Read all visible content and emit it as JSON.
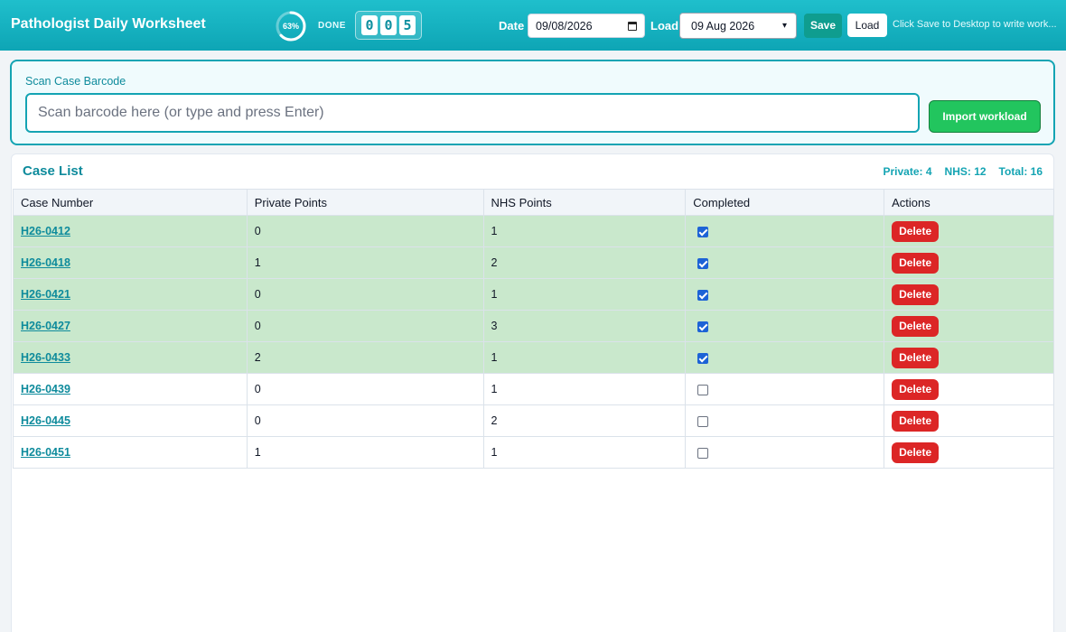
{
  "header": {
    "title": "Pathologist Daily Worksheet",
    "progress": {
      "percent_label": "63%",
      "fraction": 0.63
    },
    "done_label": "DONE",
    "counter_digits": [
      "0",
      "0",
      "5"
    ],
    "date_label": "Date",
    "date_value": "09/08/2026",
    "load_label": "Load",
    "load_selected": "09 Aug 2026",
    "save_label": "Save",
    "load_button_label": "Load",
    "hint": "Click Save to Desktop to write work..."
  },
  "scan": {
    "label": "Scan Case Barcode",
    "placeholder": "Scan barcode here (or type and press Enter)",
    "import_label": "Import workload"
  },
  "case_list": {
    "title": "Case List",
    "stats": {
      "private": "Private: 4",
      "nhs": "NHS: 12",
      "total": "Total: 16"
    },
    "columns": [
      "Case Number",
      "Private Points",
      "NHS Points",
      "Completed",
      "Actions"
    ],
    "delete_label": "Delete",
    "rows": [
      {
        "case": "H26-0412",
        "private": "0",
        "nhs": "1",
        "completed": true
      },
      {
        "case": "H26-0418",
        "private": "1",
        "nhs": "2",
        "completed": true
      },
      {
        "case": "H26-0421",
        "private": "0",
        "nhs": "1",
        "completed": true
      },
      {
        "case": "H26-0427",
        "private": "0",
        "nhs": "3",
        "completed": true
      },
      {
        "case": "H26-0433",
        "private": "2",
        "nhs": "1",
        "completed": true
      },
      {
        "case": "H26-0439",
        "private": "0",
        "nhs": "1",
        "completed": false
      },
      {
        "case": "H26-0445",
        "private": "0",
        "nhs": "2",
        "completed": false
      },
      {
        "case": "H26-0451",
        "private": "1",
        "nhs": "1",
        "completed": false
      }
    ]
  },
  "colors": {
    "header_start": "#1fbfcc",
    "header_end": "#0ea5b5",
    "accent": "#14a4b3",
    "completed_row": "#c9e8cc",
    "delete": "#dc2626",
    "import": "#22c55e",
    "save": "#0f9d8f"
  }
}
